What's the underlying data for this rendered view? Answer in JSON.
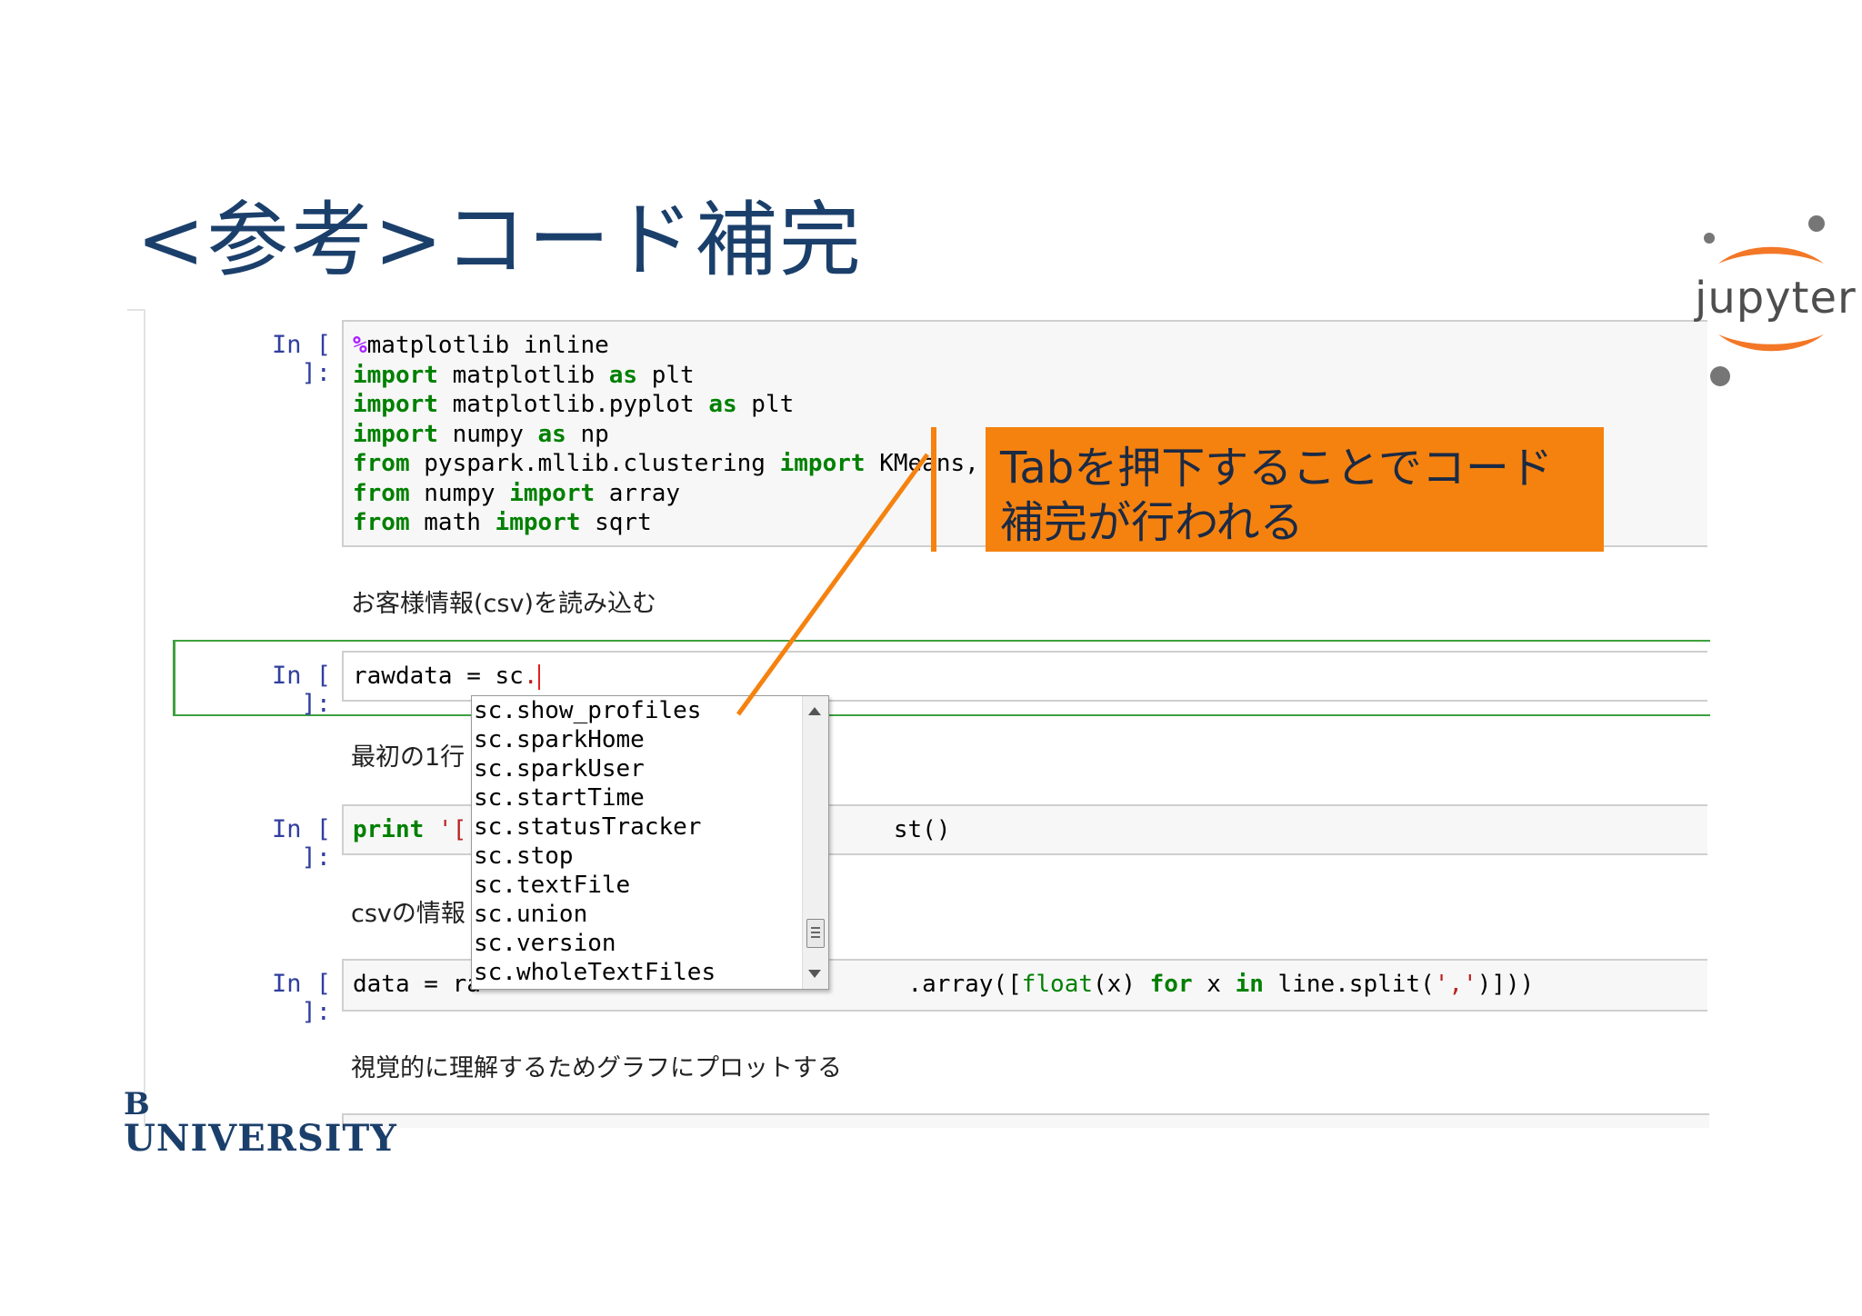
{
  "slide": {
    "title": "<参考>コード補完"
  },
  "notebook": {
    "cells": [
      {
        "prompt": "In [ ]:",
        "lines": [
          [
            {
              "t": "%",
              "c": "mg"
            },
            {
              "t": "matplotlib inline",
              "c": ""
            }
          ],
          [
            {
              "t": "import",
              "c": "kw"
            },
            {
              "t": " matplotlib ",
              "c": ""
            },
            {
              "t": "as",
              "c": "kw"
            },
            {
              "t": " plt",
              "c": ""
            }
          ],
          [
            {
              "t": "import",
              "c": "kw"
            },
            {
              "t": " matplotlib.pyplot ",
              "c": ""
            },
            {
              "t": "as",
              "c": "kw"
            },
            {
              "t": " plt",
              "c": ""
            }
          ],
          [
            {
              "t": "import",
              "c": "kw"
            },
            {
              "t": " numpy ",
              "c": ""
            },
            {
              "t": "as",
              "c": "kw"
            },
            {
              "t": " np",
              "c": ""
            }
          ],
          [
            {
              "t": "from",
              "c": "kw"
            },
            {
              "t": " pyspark.mllib.clustering ",
              "c": ""
            },
            {
              "t": "import",
              "c": "kw"
            },
            {
              "t": " KMeans, ",
              "c": ""
            }
          ],
          [
            {
              "t": "from",
              "c": "kw"
            },
            {
              "t": " numpy ",
              "c": ""
            },
            {
              "t": "import",
              "c": "kw"
            },
            {
              "t": " array",
              "c": ""
            }
          ],
          [
            {
              "t": "from",
              "c": "kw"
            },
            {
              "t": " math ",
              "c": ""
            },
            {
              "t": "import",
              "c": "kw"
            },
            {
              "t": " sqrt",
              "c": ""
            }
          ]
        ]
      },
      {
        "prompt": "In [ ]:",
        "lines": [
          [
            {
              "t": "rawdata = sc",
              "c": ""
            },
            {
              "t": ".",
              "c": "str"
            }
          ]
        ]
      },
      {
        "prompt": "In [ ]:",
        "lines": [
          [
            {
              "t": "print",
              "c": "kw"
            },
            {
              "t": " '[",
              "c": "str"
            },
            {
              "t": "                              ",
              "c": ""
            },
            {
              "t": "st()",
              "c": ""
            }
          ]
        ]
      },
      {
        "prompt": "In [ ]:",
        "lines": [
          [
            {
              "t": "data = ra",
              "c": ""
            },
            {
              "t": "                              ",
              "c": ""
            },
            {
              "t": ".array([",
              "c": ""
            },
            {
              "t": "float",
              "c": "num"
            },
            {
              "t": "(x) ",
              "c": ""
            },
            {
              "t": "for",
              "c": "kw"
            },
            {
              "t": " x ",
              "c": ""
            },
            {
              "t": "in",
              "c": "kw"
            },
            {
              "t": " line.split(",
              "c": ""
            },
            {
              "t": "','",
              "c": "str"
            },
            {
              "t": ")]))",
              "c": ""
            }
          ]
        ]
      }
    ],
    "markdown": {
      "m1": "お客様情報(csv)を読み込む",
      "m2": "最初の1行",
      "m3": "csvの情報",
      "m4": "視覚的に理解するためグラフにプロットする"
    }
  },
  "autocomplete": {
    "items": [
      "sc.show_profiles",
      "sc.sparkHome",
      "sc.sparkUser",
      "sc.startTime",
      "sc.statusTracker",
      "sc.stop",
      "sc.textFile",
      "sc.union",
      "sc.version",
      "sc.wholeTextFiles"
    ]
  },
  "callout": {
    "text": "Tabを押下することでコード補完が行われる",
    "color": "#f5820f"
  },
  "logo": {
    "text": "jupyter",
    "accent": "#f37726"
  },
  "branding": {
    "b": "B",
    "name": "UNIVERSITY"
  }
}
